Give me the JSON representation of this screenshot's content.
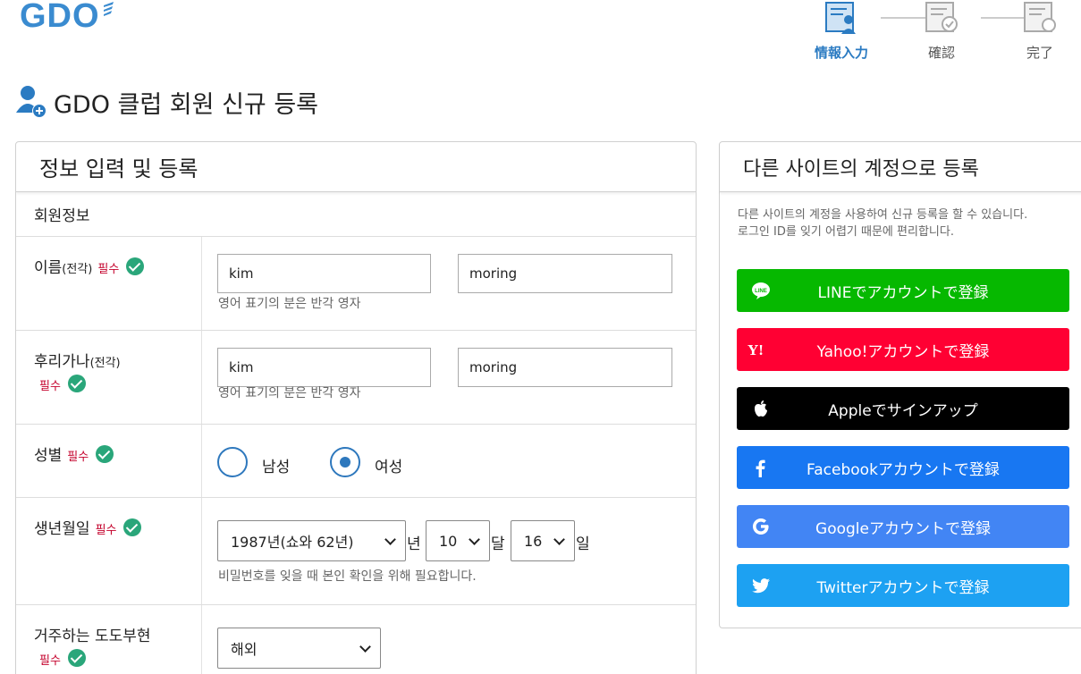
{
  "logo": {
    "text": "GDO"
  },
  "steps": [
    {
      "label": "情報入力",
      "active": true,
      "icon": "form-input-icon"
    },
    {
      "label": "確認",
      "active": false,
      "icon": "confirm-icon"
    },
    {
      "label": "完了",
      "active": false,
      "icon": "complete-icon"
    }
  ],
  "page_title": "GDO 클럽 회원 신규 등록",
  "left_panel": {
    "title": "정보 입력 및 등록",
    "section": "회원정보",
    "name_row": {
      "label": "이름",
      "sub": "(전각)",
      "required": "필수",
      "first": "kim",
      "last": "moring",
      "hint": "영어 표기의 분은 반각 영자"
    },
    "furigana_row": {
      "label": "후리가나",
      "sub": "(전각)",
      "required": "필수",
      "first": "kim",
      "last": "moring",
      "hint": "영어 표기의 분은 반각 영자"
    },
    "gender_row": {
      "label": "성별",
      "required": "필수",
      "male": "남성",
      "female": "여성",
      "selected": "female"
    },
    "birth_row": {
      "label": "생년월일",
      "required": "필수",
      "year": "1987년(쇼와 62년)",
      "year_unit": "년",
      "month": "10",
      "month_unit": "달",
      "day": "16",
      "day_unit": "일",
      "hint": "비밀번호를 잊을 때 본인 확인을 위해 필요합니다."
    },
    "pref_row": {
      "label": "거주하는 도도부현",
      "required": "필수",
      "value": "해외"
    }
  },
  "right_panel": {
    "title": "다른 사이트의 계정으로 등록",
    "desc_line1": "다른 사이트의 계정을 사용하여 신규 등록을 할 수 있습니다.",
    "desc_line2": "로그인 ID를 잊기 어렵기 때문에 편리합니다.",
    "buttons": [
      {
        "label": "LINEでアカウントで登録",
        "color": "#06b800",
        "icon": "line-icon"
      },
      {
        "label": "Yahoo!アカウントで登録",
        "color": "#ff0033",
        "icon": "yahoo-icon"
      },
      {
        "label": "Appleでサインアップ",
        "color": "#000000",
        "icon": "apple-icon"
      },
      {
        "label": "Facebookアカウントで登録",
        "color": "#1877f2",
        "icon": "facebook-icon"
      },
      {
        "label": "Googleアカウントで登録",
        "color": "#4285f4",
        "icon": "google-icon"
      },
      {
        "label": "Twitterアカウントで登録",
        "color": "#1da1f2",
        "icon": "twitter-icon"
      }
    ]
  },
  "colors": {
    "accent": "#2b7bc2",
    "required": "#c4002b",
    "check": "#2aa67a"
  }
}
